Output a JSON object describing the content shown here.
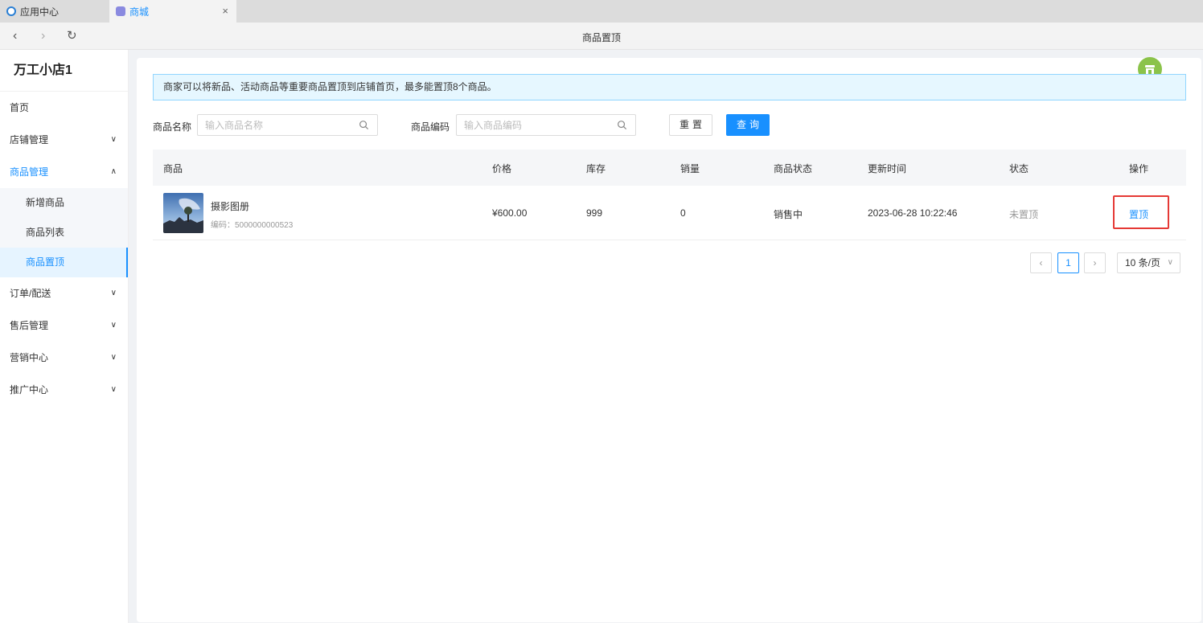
{
  "tabs": [
    {
      "label": "应用中心"
    },
    {
      "label": "商城",
      "close": "×"
    }
  ],
  "nav": {
    "back": "‹",
    "forward": "›",
    "refresh": "↻",
    "title": "商品置顶"
  },
  "sidebar": {
    "shop_name": "万工小店1",
    "items": [
      {
        "label": "首页"
      },
      {
        "label": "店铺管理"
      },
      {
        "label": "商品管理"
      },
      {
        "label": "订单/配送"
      },
      {
        "label": "售后管理"
      },
      {
        "label": "营销中心"
      },
      {
        "label": "推广中心"
      }
    ],
    "sub_items": [
      {
        "label": "新增商品"
      },
      {
        "label": "商品列表"
      },
      {
        "label": "商品置顶"
      }
    ]
  },
  "notice": "商家可以将新品、活动商品等重要商品置顶到店铺首页，最多能置顶8个商品。",
  "filters": {
    "name_label": "商品名称",
    "name_placeholder": "输入商品名称",
    "code_label": "商品编码",
    "code_placeholder": "输入商品编码",
    "reset": "重置",
    "query": "查询"
  },
  "table": {
    "headers": [
      "商品",
      "价格",
      "库存",
      "销量",
      "商品状态",
      "更新时间",
      "状态",
      "操作"
    ],
    "rows": [
      {
        "name": "摄影图册",
        "code": "编码：5000000000523",
        "price": "¥600.00",
        "stock": "999",
        "sales": "0",
        "product_status": "销售中",
        "updated": "2023-06-28 10:22:46",
        "status": "未置顶",
        "action": "置顶"
      }
    ]
  },
  "pagination": {
    "prev": "‹",
    "current": "1",
    "next": "›",
    "page_size": "10 条/页"
  },
  "colors": {
    "primary": "#1890ff",
    "highlight": "#e53935",
    "float_button": "#8bc34a"
  }
}
